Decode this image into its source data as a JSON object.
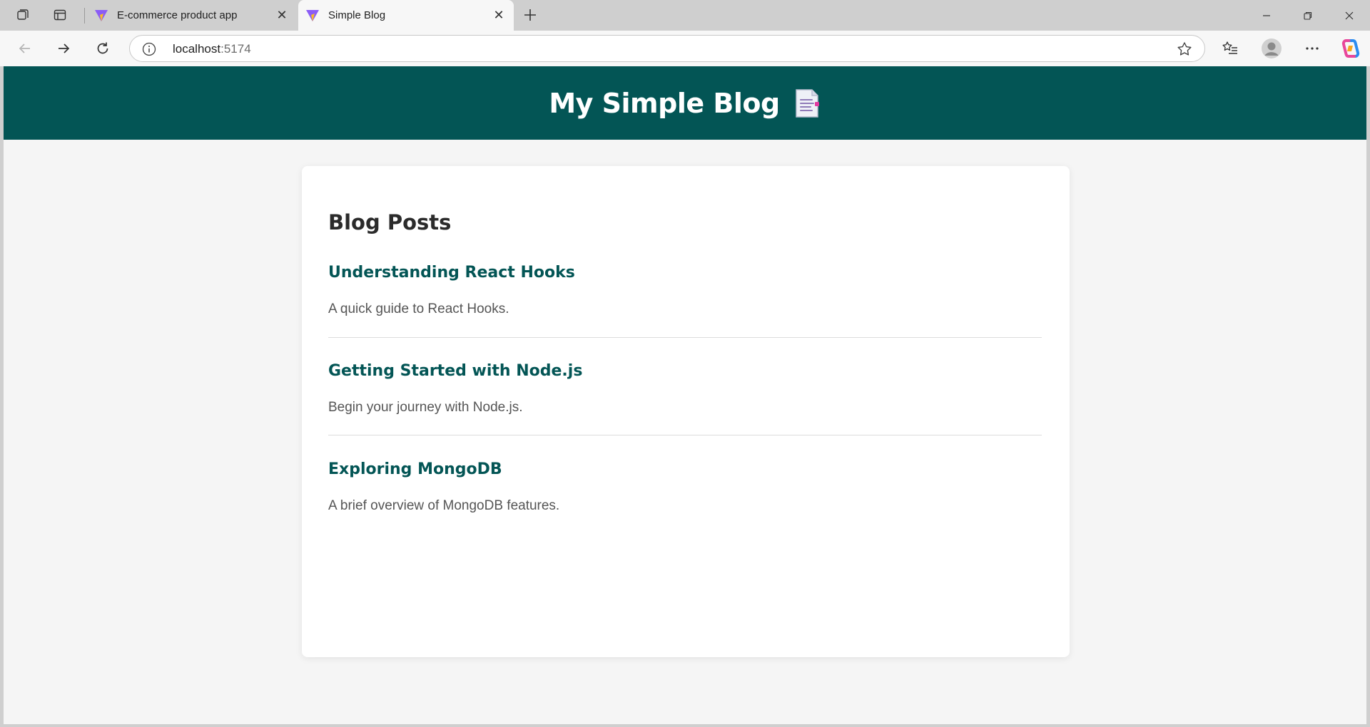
{
  "browser": {
    "tabs": [
      {
        "title": "E-commerce product app",
        "active": false
      },
      {
        "title": "Simple Blog",
        "active": true
      }
    ],
    "address": {
      "host": "localhost",
      "port": ":5174"
    }
  },
  "site": {
    "title": "My Simple Blog",
    "title_emoji": "page-with-text-icon",
    "header_color": "#035555"
  },
  "blog": {
    "heading": "Blog Posts",
    "posts": [
      {
        "title": "Understanding React Hooks",
        "excerpt": "A quick guide to React Hooks."
      },
      {
        "title": "Getting Started with Node.js",
        "excerpt": "Begin your journey with Node.js."
      },
      {
        "title": "Exploring MongoDB",
        "excerpt": "A brief overview of MongoDB features."
      }
    ]
  },
  "colors": {
    "accent": "#035555",
    "page_bg": "#f5f5f5",
    "card_bg": "#ffffff"
  }
}
